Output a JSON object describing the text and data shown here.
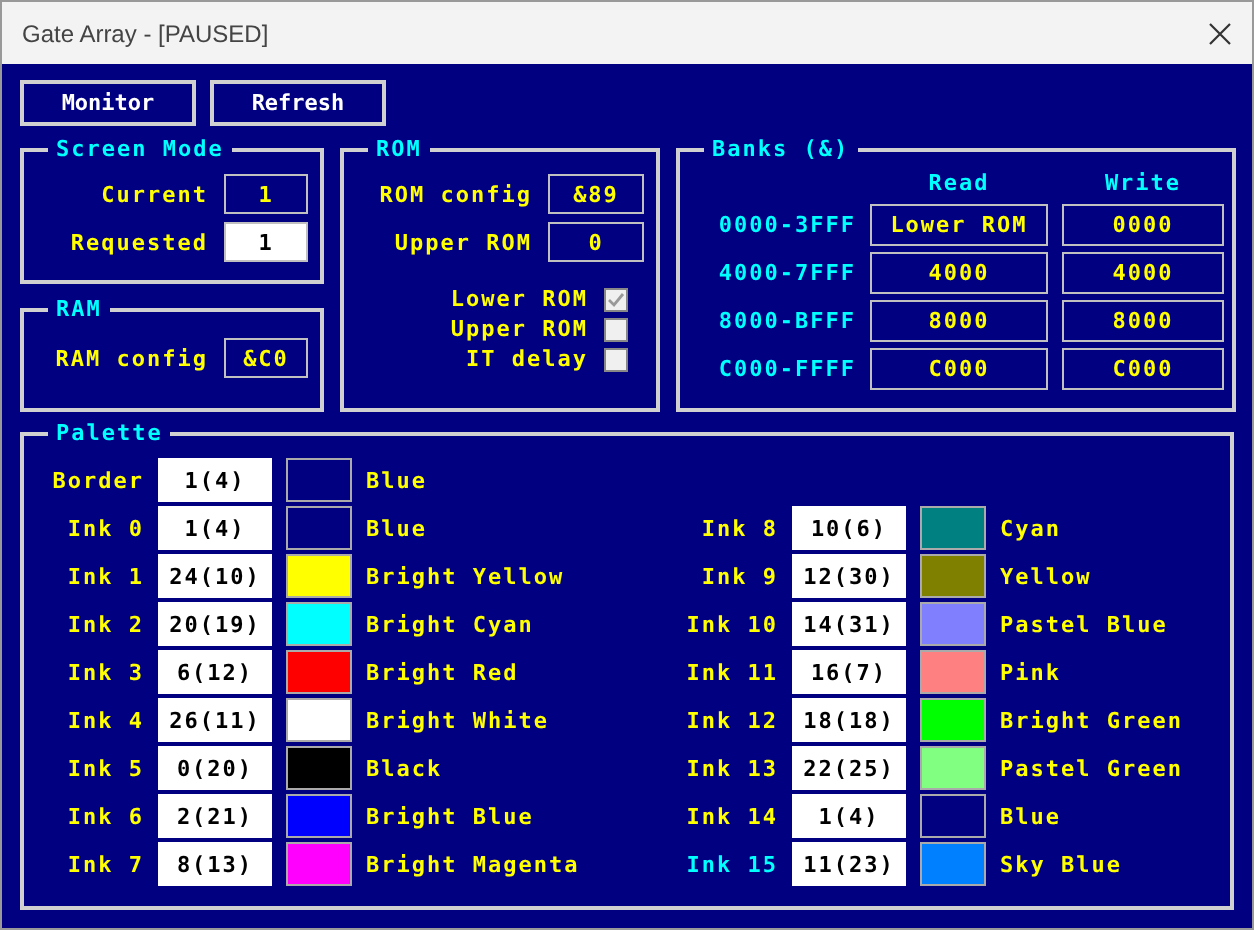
{
  "window": {
    "title": "Gate Array - [PAUSED]"
  },
  "toolbar": [
    "Monitor",
    "Refresh"
  ],
  "screen_mode": {
    "title": "Screen Mode",
    "fields": [
      {
        "label": "Current",
        "value": "1",
        "editable": false
      },
      {
        "label": "Requested",
        "value": "1",
        "editable": true
      }
    ]
  },
  "ram": {
    "title": "RAM",
    "fields": [
      {
        "label": "RAM config",
        "value": "&C0",
        "editable": false
      }
    ]
  },
  "rom": {
    "title": "ROM",
    "fields": [
      {
        "label": "ROM config",
        "value": "&89",
        "editable": false
      },
      {
        "label": "Upper ROM",
        "value": "0",
        "editable": false
      }
    ],
    "checkboxes": [
      {
        "label": "Lower ROM",
        "checked": true
      },
      {
        "label": "Upper ROM",
        "checked": false
      },
      {
        "label": "IT delay",
        "checked": false
      }
    ]
  },
  "banks": {
    "title": "Banks (&)",
    "columns": [
      "Read",
      "Write"
    ],
    "rows": [
      {
        "range": "0000-3FFF",
        "read": "Lower ROM",
        "write": "0000"
      },
      {
        "range": "4000-7FFF",
        "read": "4000",
        "write": "4000"
      },
      {
        "range": "8000-BFFF",
        "read": "8000",
        "write": "8000"
      },
      {
        "range": "C000-FFFF",
        "read": "C000",
        "write": "C000"
      }
    ]
  },
  "palette": {
    "title": "Palette",
    "columns": [
      [
        {
          "label": "Border",
          "value": "1(4)",
          "color": "#000080",
          "name": "Blue",
          "selected": false
        },
        {
          "label": "Ink 0",
          "value": "1(4)",
          "color": "#000080",
          "name": "Blue",
          "selected": false
        },
        {
          "label": "Ink 1",
          "value": "24(10)",
          "color": "#ffff00",
          "name": "Bright Yellow",
          "selected": false
        },
        {
          "label": "Ink 2",
          "value": "20(19)",
          "color": "#00ffff",
          "name": "Bright Cyan",
          "selected": false
        },
        {
          "label": "Ink 3",
          "value": "6(12)",
          "color": "#ff0000",
          "name": "Bright Red",
          "selected": false
        },
        {
          "label": "Ink 4",
          "value": "26(11)",
          "color": "#ffffff",
          "name": "Bright White",
          "selected": false
        },
        {
          "label": "Ink 5",
          "value": "0(20)",
          "color": "#000000",
          "name": "Black",
          "selected": false
        },
        {
          "label": "Ink 6",
          "value": "2(21)",
          "color": "#0000ff",
          "name": "Bright Blue",
          "selected": false
        },
        {
          "label": "Ink 7",
          "value": "8(13)",
          "color": "#ff00ff",
          "name": "Bright Magenta",
          "selected": false
        }
      ],
      [
        {
          "label": "Ink 8",
          "value": "10(6)",
          "color": "#008080",
          "name": "Cyan",
          "selected": false
        },
        {
          "label": "Ink 9",
          "value": "12(30)",
          "color": "#808000",
          "name": "Yellow",
          "selected": false
        },
        {
          "label": "Ink 10",
          "value": "14(31)",
          "color": "#8080ff",
          "name": "Pastel Blue",
          "selected": false
        },
        {
          "label": "Ink 11",
          "value": "16(7)",
          "color": "#ff8080",
          "name": "Pink",
          "selected": false
        },
        {
          "label": "Ink 12",
          "value": "18(18)",
          "color": "#00ff00",
          "name": "Bright Green",
          "selected": false
        },
        {
          "label": "Ink 13",
          "value": "22(25)",
          "color": "#80ff80",
          "name": "Pastel Green",
          "selected": false
        },
        {
          "label": "Ink 14",
          "value": "1(4)",
          "color": "#000080",
          "name": "Blue",
          "selected": false
        },
        {
          "label": "Ink 15",
          "value": "11(23)",
          "color": "#0080ff",
          "name": "Sky Blue",
          "selected": true
        }
      ]
    ]
  }
}
